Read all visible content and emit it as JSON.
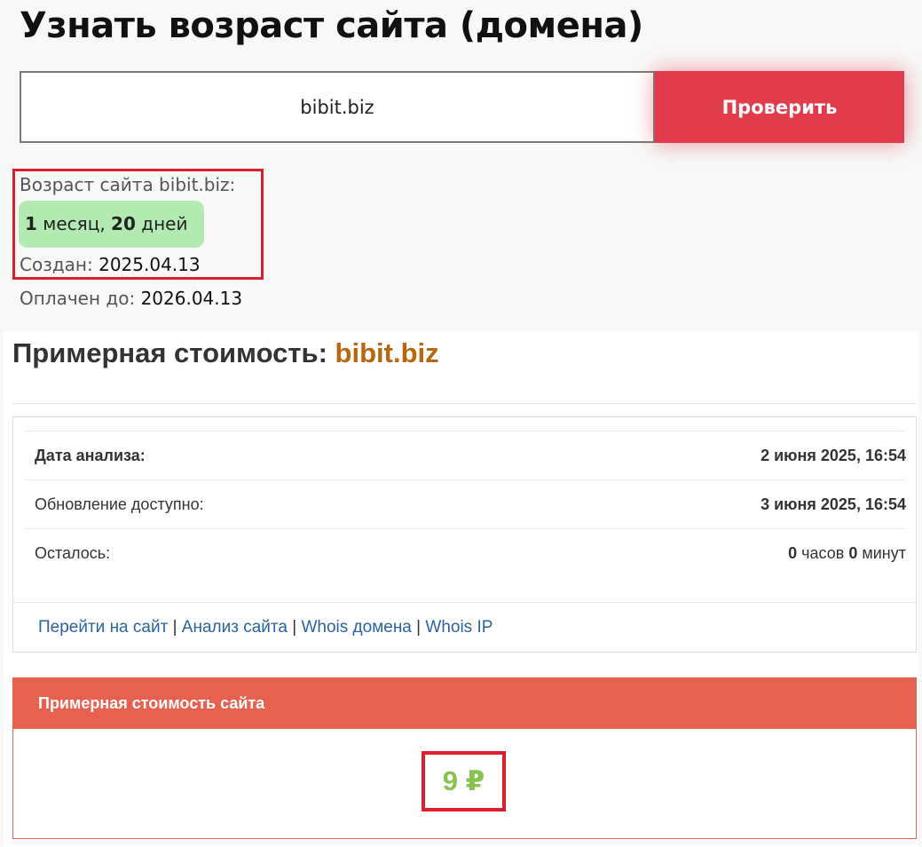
{
  "header": {
    "title": "Узнать возраст сайта (домена)"
  },
  "search": {
    "value": "bibit.biz",
    "button_label": "Проверить"
  },
  "age": {
    "label": "Возраст сайта bibit.biz:",
    "months_num": "1",
    "months_word": "месяц,",
    "days_num": "20",
    "days_word": "дней",
    "created_label": "Создан:",
    "created_value": "2025.04.13",
    "paid_label": "Оплачен до:",
    "paid_value": "2026.04.13"
  },
  "valuation": {
    "title_prefix": "Примерная стоимость:",
    "domain": "bibit.biz",
    "rows": [
      {
        "label": "Дата анализа:",
        "value": "2 июня 2025, 16:54"
      },
      {
        "label": "Обновление доступно:",
        "value": "3 июня 2025, 16:54"
      },
      {
        "label": "Осталось:",
        "hours_num": "0",
        "hours_word": "часов",
        "minutes_num": "0",
        "minutes_word": "минут"
      }
    ],
    "links": [
      "Перейти на сайт",
      "Анализ сайта",
      "Whois домена",
      "Whois IP"
    ],
    "link_separator": "|",
    "price_header": "Примерная стоимость сайта",
    "price": "9 ₽"
  },
  "colors": {
    "button": "#e03c4b",
    "badge": "#b3eab1",
    "highlight_border": "#d9202c",
    "domain_accent": "#b8670e",
    "price_header": "#e66150",
    "price_text": "#86c44e",
    "link": "#2b63a0"
  }
}
